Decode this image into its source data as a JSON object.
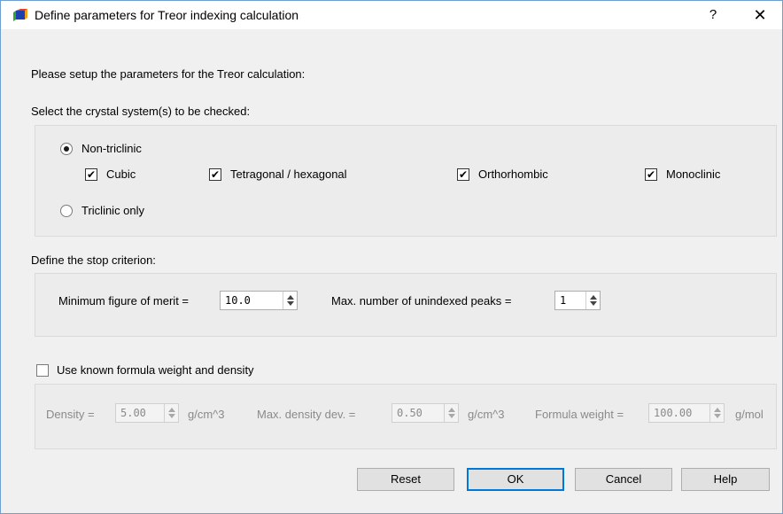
{
  "window": {
    "title": "Define parameters for Treor indexing calculation",
    "help_glyph": "?",
    "close_glyph": "✕"
  },
  "intro": "Please setup the parameters for the Treor calculation:",
  "crystal": {
    "heading": "Select the crystal system(s) to be checked:",
    "non_triclinic": {
      "label": "Non-triclinic",
      "selected": true
    },
    "triclinic_only": {
      "label": "Triclinic only",
      "selected": false
    },
    "checks": [
      {
        "label": "Cubic",
        "checked": true
      },
      {
        "label": "Tetragonal / hexagonal",
        "checked": true
      },
      {
        "label": "Orthorhombic",
        "checked": true
      },
      {
        "label": "Monoclinic",
        "checked": true
      }
    ],
    "check_mark": "✔"
  },
  "stop": {
    "heading": "Define the stop criterion:",
    "fom_label": "Minimum figure of merit =",
    "fom_value": "10.0",
    "max_unindexed_label": "Max. number of unindexed peaks =",
    "max_unindexed_value": "1"
  },
  "formula": {
    "checkbox_label": "Use known formula weight and density",
    "checked": false,
    "density_label": "Density =",
    "density_value": "5.00",
    "density_unit": "g/cm^3",
    "max_dev_label": "Max. density dev. =",
    "max_dev_value": "0.50",
    "max_dev_unit": "g/cm^3",
    "fw_label": "Formula weight =",
    "fw_value": "100.00",
    "fw_unit": "g/mol"
  },
  "buttons": {
    "reset": "Reset",
    "ok": "OK",
    "cancel": "Cancel",
    "help": "Help"
  },
  "colors": {
    "window_border": "#6f9fd0",
    "default_button_border": "#0078d7",
    "dialog_bg": "#f0f0f0"
  }
}
